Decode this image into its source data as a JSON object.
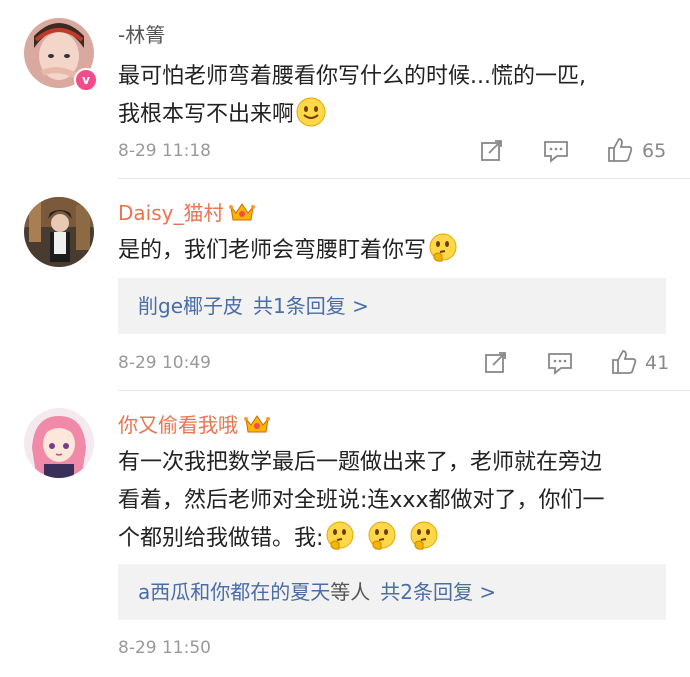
{
  "comments": [
    {
      "username": "-林箐",
      "text_line1": "最可怕老师弯着腰看你写什么的时候...慌的一匹,",
      "text_line2": "我根本写不出来啊",
      "time": "8-29 11:18",
      "likes": "65"
    },
    {
      "username": "Daisy_猫村",
      "text": "是的，我们老师会弯腰盯着你写",
      "reply_users": "削ge椰子皮",
      "reply_count": "共1条回复 >",
      "time": "8-29 10:49",
      "likes": "41"
    },
    {
      "username": "你又偷看我哦",
      "text_line1": "有一次我把数学最后一题做出来了，老师就在旁边",
      "text_line2": "看着，然后老师对全班说:连xxx都做对了，你们一",
      "text_line3": "个都别给我做错。我:",
      "reply_users": "a西瓜和你都在的夏天",
      "reply_suffix": "等人",
      "reply_count": "共2条回复 >",
      "time": "8-29 11:50"
    }
  ],
  "icons": [
    "repost-icon",
    "comment-icon",
    "like-icon",
    "crown-icon",
    "smile-emoji",
    "thinking-emoji",
    "verified-badge-icon"
  ],
  "colors": {
    "vip_name": "#eb7350",
    "reply_link": "#4a6da7",
    "meta": "#999999",
    "reply_bg": "#f2f2f2"
  }
}
